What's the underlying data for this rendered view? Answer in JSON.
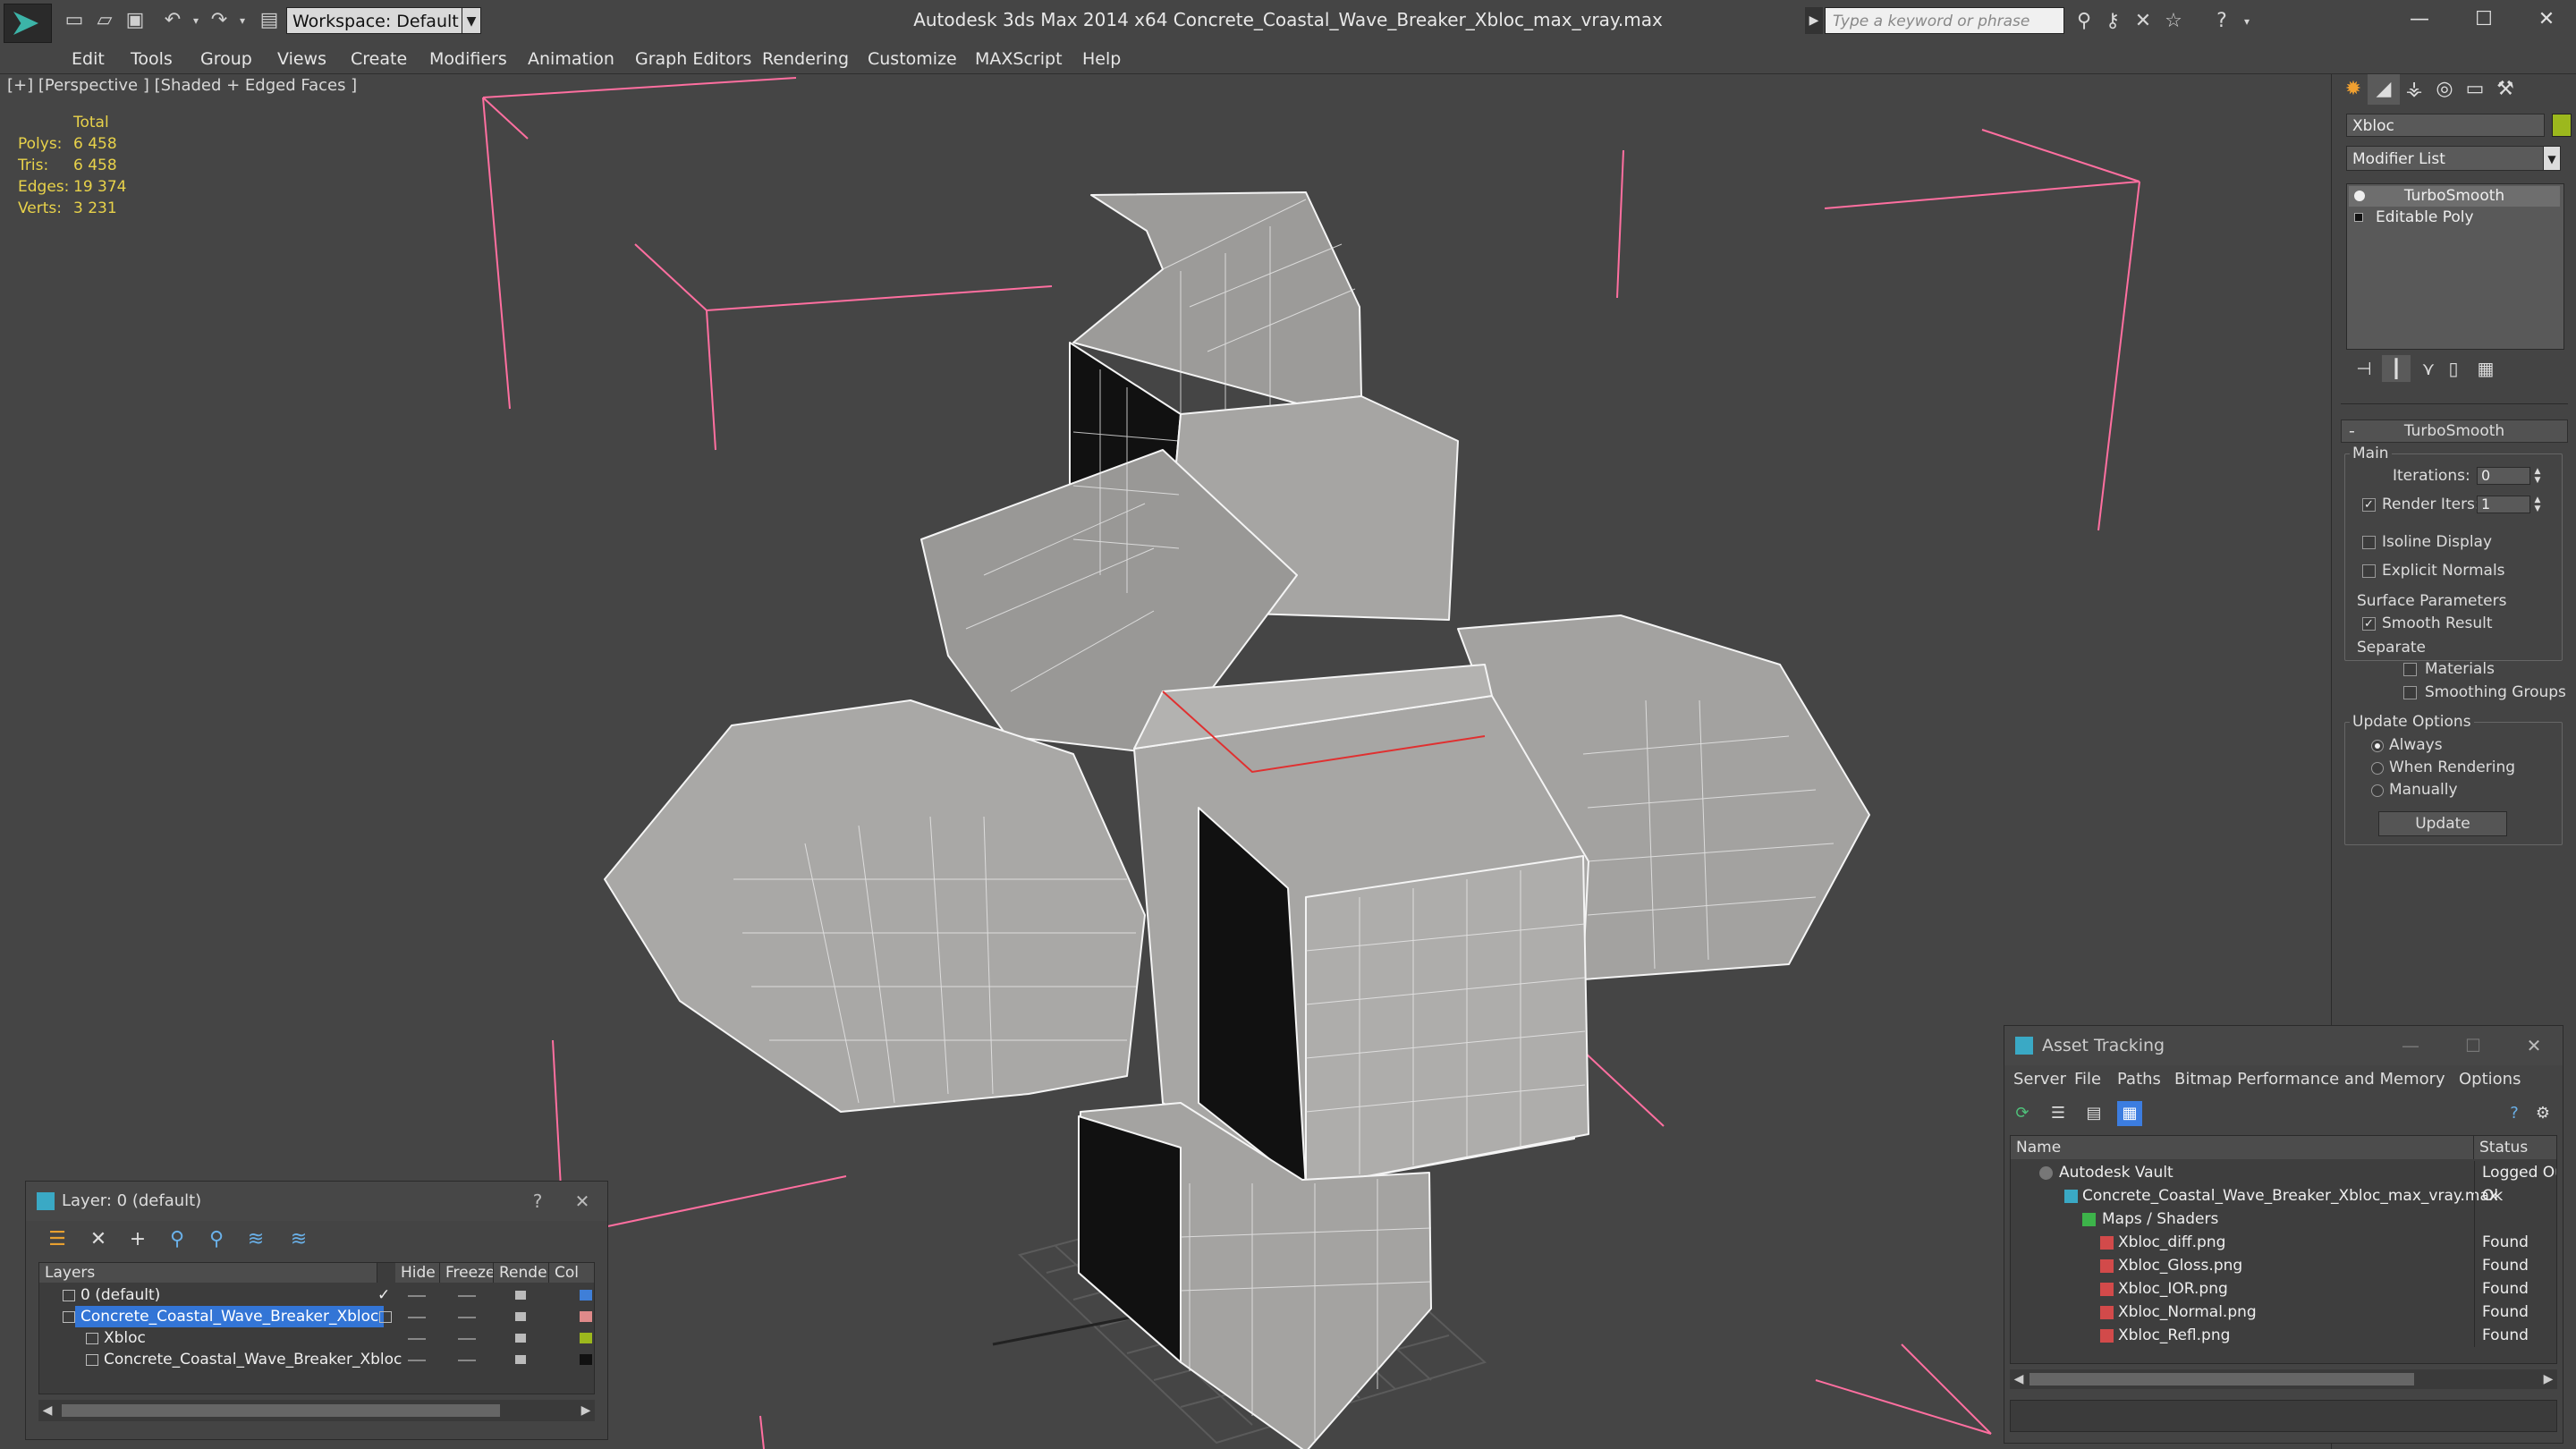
{
  "window": {
    "title": "Autodesk 3ds Max  2014 x64      Concrete_Coastal_Wave_Breaker_Xbloc_max_vray.max",
    "workspace": "Workspace: Default",
    "search_placeholder": "Type a keyword or phrase"
  },
  "menu": [
    "Edit",
    "Tools",
    "Group",
    "Views",
    "Create",
    "Modifiers",
    "Animation",
    "Graph Editors",
    "Rendering",
    "Customize",
    "MAXScript",
    "Help"
  ],
  "viewport": {
    "label": "[+] [Perspective ] [Shaded + Edged Faces ]",
    "stats": {
      "header": "Total",
      "rows": [
        {
          "label": "Polys:",
          "value": "6 458"
        },
        {
          "label": "Tris:",
          "value": "6 458"
        },
        {
          "label": "Edges:",
          "value": "19 374"
        },
        {
          "label": "Verts:",
          "value": "3 231"
        }
      ]
    }
  },
  "command_panel": {
    "object_name": "Xbloc",
    "object_color": "#9cb81d",
    "modifier_list": "Modifier List",
    "stack": [
      "TurboSmooth",
      "Editable Poly"
    ],
    "rollout": {
      "title": "TurboSmooth",
      "main_group": "Main",
      "iterations_label": "Iterations:",
      "iterations_value": "0",
      "render_iters_label": "Render Iters:",
      "render_iters_value": "1",
      "render_iters_checked": true,
      "isoline_display": "Isoline Display",
      "explicit_normals": "Explicit Normals",
      "surface_group": "Surface Parameters",
      "smooth_result": "Smooth Result",
      "separate": "Separate",
      "materials": "Materials",
      "smoothing_groups": "Smoothing Groups",
      "update_group": "Update Options",
      "always": "Always",
      "when_rendering": "When Rendering",
      "manually": "Manually",
      "update_button": "Update"
    }
  },
  "asset_tracking": {
    "title": "Asset Tracking",
    "menu": [
      "Server",
      "File",
      "Paths",
      "Bitmap Performance and Memory",
      "Options"
    ],
    "columns": [
      "Name",
      "Status"
    ],
    "rows": [
      {
        "name": "Autodesk Vault",
        "status": "Logged Out",
        "indent": 0,
        "icon": "vault-icon"
      },
      {
        "name": "Concrete_Coastal_Wave_Breaker_Xbloc_max_vray.max",
        "status": "Ok",
        "indent": 1,
        "icon": "max-file-icon"
      },
      {
        "name": "Maps / Shaders",
        "status": "",
        "indent": 2,
        "icon": "maps-folder-icon"
      },
      {
        "name": "Xbloc_diff.png",
        "status": "Found",
        "indent": 3,
        "icon": "png-icon"
      },
      {
        "name": "Xbloc_Gloss.png",
        "status": "Found",
        "indent": 3,
        "icon": "png-icon"
      },
      {
        "name": "Xbloc_IOR.png",
        "status": "Found",
        "indent": 3,
        "icon": "png-icon"
      },
      {
        "name": "Xbloc_Normal.png",
        "status": "Found",
        "indent": 3,
        "icon": "png-icon"
      },
      {
        "name": "Xbloc_Refl.png",
        "status": "Found",
        "indent": 3,
        "icon": "png-icon"
      }
    ]
  },
  "layer_explorer": {
    "title": "Layer: 0 (default)",
    "columns": [
      "Layers",
      "Hide",
      "Freeze",
      "Render",
      "Col"
    ],
    "rows": [
      {
        "name": "0 (default)",
        "selected": false,
        "color": "#3f7fd8",
        "level": 0
      },
      {
        "name": "Concrete_Coastal_Wave_Breaker_Xbloc",
        "selected": true,
        "color": "#e08a8a",
        "level": 0
      },
      {
        "name": "Xbloc",
        "selected": false,
        "color": "#9cb81d",
        "level": 1
      },
      {
        "name": "Concrete_Coastal_Wave_Breaker_Xbloc",
        "selected": false,
        "color": "#111111",
        "level": 1
      }
    ]
  }
}
